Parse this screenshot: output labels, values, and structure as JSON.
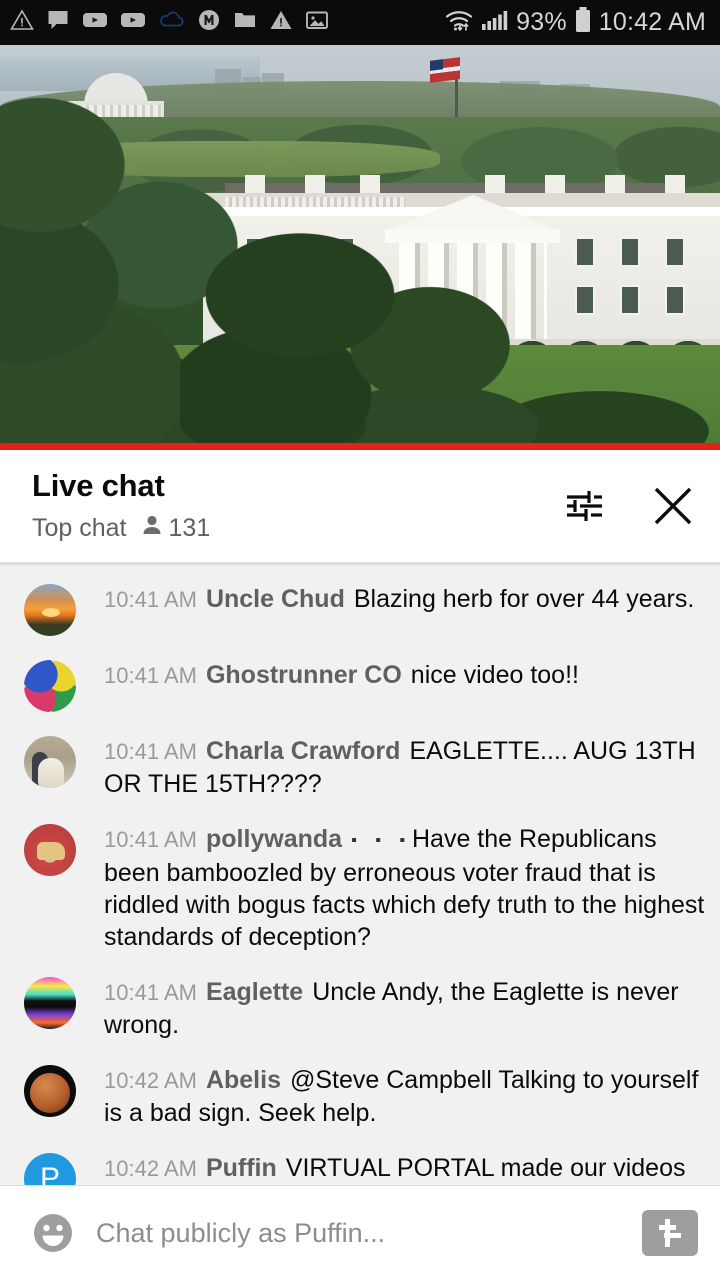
{
  "status_bar": {
    "icons_left": [
      "warning-triangle-icon",
      "chat-bubble-icon",
      "youtube-play-icon",
      "youtube-play-icon",
      "cloud-outline-icon",
      "m-circle-icon",
      "folder-icon",
      "warning-triangle-icon",
      "photo-icon"
    ],
    "wifi_icon": "wifi-icon",
    "signal_icon": "cellular-signal-icon",
    "battery_percent": "93%",
    "battery_icon": "battery-icon",
    "clock": "10:42 AM"
  },
  "video": {
    "name": "white-house-live-stream",
    "progress_color": "#e62117",
    "progress_percent": 100
  },
  "chat_header": {
    "title": "Live chat",
    "mode": "Top chat",
    "viewer_icon": "person-icon",
    "viewer_count": "131",
    "settings_icon": "tune-sliders-icon",
    "close_icon": "close-icon"
  },
  "messages": [
    {
      "time": "10:41 AM",
      "author": "Uncle Chud",
      "text": "Blazing herb for over 44 years.",
      "avatar": "av-sunset",
      "avatar_letter": ""
    },
    {
      "time": "10:41 AM",
      "author": "Ghostrunner CO",
      "text": "nice video too!!",
      "avatar": "av-colors",
      "avatar_letter": ""
    },
    {
      "time": "10:41 AM",
      "author": "Charla Crawford",
      "text": "EAGLETTE.... AUG 13TH OR THE 15TH????",
      "avatar": "av-couple",
      "avatar_letter": ""
    },
    {
      "time": "10:41 AM",
      "author": "pollywanda",
      "bullets": "▪ ▪ ▪",
      "text": "Have the Republicans been bamboozled by erroneous voter fraud that is riddled with bogus facts which defy truth to the highest standards of deception?",
      "avatar": "av-lion",
      "avatar_letter": ""
    },
    {
      "time": "10:41 AM",
      "author": "Eaglette",
      "text": "Uncle Andy, the Eaglette is never wrong.",
      "avatar": "av-neon",
      "avatar_letter": ""
    },
    {
      "time": "10:42 AM",
      "author": "Abelis",
      "text": "@Steve Campbell Talking to yourself is a bad sign. Seek help.",
      "avatar": "av-moon",
      "avatar_letter": ""
    },
    {
      "time": "10:42 AM",
      "author": "Puffin",
      "text": "VIRTUAL PORTAL made our videos",
      "avatar": "av-letter",
      "avatar_letter": "P"
    }
  ],
  "input_bar": {
    "emoji_icon": "emoji-smiley-icon",
    "placeholder": "Chat publicly as Puffin...",
    "superchat_icon": "super-chat-dollar-icon"
  },
  "colors": {
    "youtube_red": "#e62117",
    "chat_bg": "#f1f1f1",
    "author_gray": "#606060",
    "time_gray": "#9a9a9a",
    "avatar_blue": "#1f9ae0"
  }
}
